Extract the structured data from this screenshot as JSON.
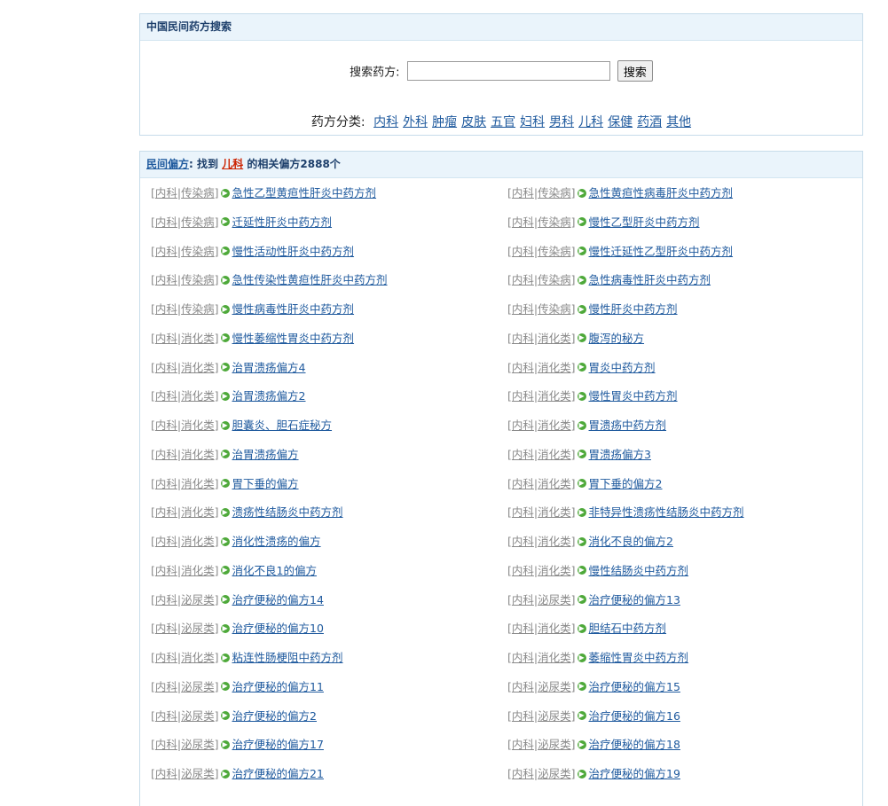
{
  "search": {
    "header": "中国民间药方搜索",
    "label": "搜索药方:",
    "input_value": "",
    "button": "搜索",
    "categories_label": "药方分类:",
    "categories": [
      "内科",
      "外科",
      "肿瘤",
      "皮肤",
      "五官",
      "妇科",
      "男科",
      "儿科",
      "保健",
      "药酒",
      "其他"
    ]
  },
  "results": {
    "head_link": "民间偏方",
    "head_find": ": 找到",
    "head_category": "儿科",
    "head_suffix": "的相关偏方2888个",
    "items": [
      {
        "dept": "内科",
        "sub": "传染病",
        "title": "急性乙型黄疸性肝炎中药方剂"
      },
      {
        "dept": "内科",
        "sub": "传染病",
        "title": "急性黄疸性病毒肝炎中药方剂"
      },
      {
        "dept": "内科",
        "sub": "传染病",
        "title": "迁延性肝炎中药方剂"
      },
      {
        "dept": "内科",
        "sub": "传染病",
        "title": "慢性乙型肝炎中药方剂"
      },
      {
        "dept": "内科",
        "sub": "传染病",
        "title": "慢性活动性肝炎中药方剂"
      },
      {
        "dept": "内科",
        "sub": "传染病",
        "title": "慢性迁延性乙型肝炎中药方剂"
      },
      {
        "dept": "内科",
        "sub": "传染病",
        "title": "急性传染性黄疸性肝炎中药方剂"
      },
      {
        "dept": "内科",
        "sub": "传染病",
        "title": "急性病毒性肝炎中药方剂"
      },
      {
        "dept": "内科",
        "sub": "传染病",
        "title": "慢性病毒性肝炎中药方剂"
      },
      {
        "dept": "内科",
        "sub": "传染病",
        "title": "慢性肝炎中药方剂"
      },
      {
        "dept": "内科",
        "sub": "消化类",
        "title": "慢性萎缩性胃炎中药方剂"
      },
      {
        "dept": "内科",
        "sub": "消化类",
        "title": "腹泻的秘方"
      },
      {
        "dept": "内科",
        "sub": "消化类",
        "title": "治胃溃疡偏方4"
      },
      {
        "dept": "内科",
        "sub": "消化类",
        "title": "胃炎中药方剂"
      },
      {
        "dept": "内科",
        "sub": "消化类",
        "title": "治胃溃疡偏方2"
      },
      {
        "dept": "内科",
        "sub": "消化类",
        "title": "慢性胃炎中药方剂"
      },
      {
        "dept": "内科",
        "sub": "消化类",
        "title": "胆囊炎、胆石症秘方"
      },
      {
        "dept": "内科",
        "sub": "消化类",
        "title": "胃溃疡中药方剂"
      },
      {
        "dept": "内科",
        "sub": "消化类",
        "title": "治胃溃疡偏方"
      },
      {
        "dept": "内科",
        "sub": "消化类",
        "title": "胃溃疡偏方3"
      },
      {
        "dept": "内科",
        "sub": "消化类",
        "title": "胃下垂的偏方"
      },
      {
        "dept": "内科",
        "sub": "消化类",
        "title": "胃下垂的偏方2"
      },
      {
        "dept": "内科",
        "sub": "消化类",
        "title": "溃疡性结肠炎中药方剂"
      },
      {
        "dept": "内科",
        "sub": "消化类",
        "title": "非特异性溃疡性结肠炎中药方剂"
      },
      {
        "dept": "内科",
        "sub": "消化类",
        "title": "消化性溃疡的偏方"
      },
      {
        "dept": "内科",
        "sub": "消化类",
        "title": "消化不良的偏方2"
      },
      {
        "dept": "内科",
        "sub": "消化类",
        "title": "消化不良1的偏方"
      },
      {
        "dept": "内科",
        "sub": "消化类",
        "title": "慢性结肠炎中药方剂"
      },
      {
        "dept": "内科",
        "sub": "泌尿类",
        "title": "治疗便秘的偏方14"
      },
      {
        "dept": "内科",
        "sub": "泌尿类",
        "title": "治疗便秘的偏方13"
      },
      {
        "dept": "内科",
        "sub": "泌尿类",
        "title": "治疗便秘的偏方10"
      },
      {
        "dept": "内科",
        "sub": "消化类",
        "title": "胆结石中药方剂"
      },
      {
        "dept": "内科",
        "sub": "消化类",
        "title": "粘连性肠梗阻中药方剂"
      },
      {
        "dept": "内科",
        "sub": "消化类",
        "title": "萎缩性胃炎中药方剂"
      },
      {
        "dept": "内科",
        "sub": "泌尿类",
        "title": "治疗便秘的偏方11"
      },
      {
        "dept": "内科",
        "sub": "泌尿类",
        "title": "治疗便秘的偏方15"
      },
      {
        "dept": "内科",
        "sub": "泌尿类",
        "title": "治疗便秘的偏方2"
      },
      {
        "dept": "内科",
        "sub": "泌尿类",
        "title": "治疗便秘的偏方16"
      },
      {
        "dept": "内科",
        "sub": "泌尿类",
        "title": "治疗便秘的偏方17"
      },
      {
        "dept": "内科",
        "sub": "泌尿类",
        "title": "治疗便秘的偏方18"
      },
      {
        "dept": "内科",
        "sub": "泌尿类",
        "title": "治疗便秘的偏方21"
      },
      {
        "dept": "内科",
        "sub": "泌尿类",
        "title": "治疗便秘的偏方19"
      }
    ]
  }
}
